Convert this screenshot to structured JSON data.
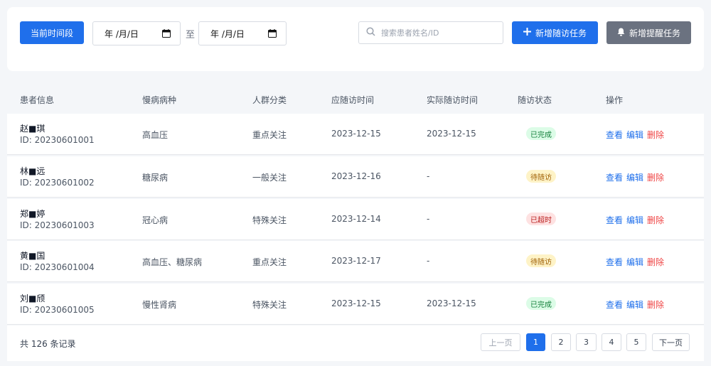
{
  "toolbar": {
    "period_button": "当前时间段",
    "date_from_placeholder": "年 /月/日",
    "date_to_placeholder": "年 /月/日",
    "to_label": "至",
    "search_placeholder": "搜索患者姓名/ID",
    "add_followup_button": "新增随访任务",
    "add_reminder_button": "新增提醒任务",
    "colors": {
      "primary": "#1f6feb",
      "secondary": "#6b7280"
    }
  },
  "table": {
    "headers": [
      "患者信息",
      "慢病病种",
      "人群分类",
      "应随访时间",
      "实际随访时间",
      "随访状态",
      "操作"
    ],
    "rows": [
      {
        "name": "赵■琪",
        "id": "ID: 20230601001",
        "disease": "高血压",
        "group": "重点关注",
        "due": "2023-12-15",
        "actual": "2023-12-15",
        "status": "已完成",
        "status_type": "done"
      },
      {
        "name": "林■远",
        "id": "ID: 20230601002",
        "disease": "糖尿病",
        "group": "一般关注",
        "due": "2023-12-16",
        "actual": "-",
        "status": "待随访",
        "status_type": "pending"
      },
      {
        "name": "郑■婷",
        "id": "ID: 20230601003",
        "disease": "冠心病",
        "group": "特殊关注",
        "due": "2023-12-14",
        "actual": "-",
        "status": "已超时",
        "status_type": "overdue"
      },
      {
        "name": "黄■国",
        "id": "ID: 20230601004",
        "disease": "高血压、糖尿病",
        "group": "重点关注",
        "due": "2023-12-17",
        "actual": "-",
        "status": "待随访",
        "status_type": "pending"
      },
      {
        "name": "刘■颀",
        "id": "ID: 20230601005",
        "disease": "慢性肾病",
        "group": "特殊关注",
        "due": "2023-12-15",
        "actual": "2023-12-15",
        "status": "已完成",
        "status_type": "done"
      }
    ],
    "actions": {
      "view": "查看",
      "edit": "编辑",
      "delete": "删除"
    },
    "status_colors": {
      "done": "#15803d",
      "pending": "#a16207",
      "overdue": "#b91c1c"
    }
  },
  "pagination": {
    "total": "共 126 条记录",
    "prev": "上一页",
    "pages": [
      "1",
      "2",
      "3",
      "4",
      "5"
    ],
    "current": "1",
    "next": "下一页"
  }
}
